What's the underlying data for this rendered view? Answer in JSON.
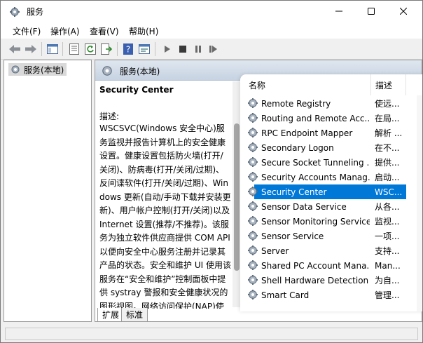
{
  "window": {
    "title": "服务"
  },
  "menu": [
    {
      "label": "文件(F)"
    },
    {
      "label": "操作(A)"
    },
    {
      "label": "查看(V)"
    },
    {
      "label": "帮助(H)"
    }
  ],
  "toolbar": {
    "icons": [
      "back-icon",
      "forward-icon",
      "show-tree-icon",
      "properties-icon",
      "refresh-icon",
      "export-icon",
      "help-icon",
      "console-icon",
      "start-icon",
      "stop-icon",
      "pause-icon",
      "restart-icon"
    ]
  },
  "tree": {
    "root": "服务(本地)"
  },
  "pane": {
    "header": "服务(本地)",
    "service_title": "Security Center",
    "desc_label": "描述:",
    "desc_text": "WSCSVC(Windows 安全中心)服务监视并报告计算机上的安全健康设置。健康设置包括防火墙(打开/关闭)、防病毒(打开/关闭/过期)、反间谍软件(打开/关闭/过期)、Windows 更新(自动/手动下载并安装更新)、用户帐户控制(打开/关闭)以及 Internet 设置(推荐/不推荐)。该服务为独立软件供应商提供 COM API 以便向安全中心服务注册并记录其产品的状态。安全和维护 UI 使用该服务在“安全和维护”控制面板中提供 systray 警报和安全健康状况的图形视图。网络访问保护(NAP)使用该服务向 NAP 网络策略服务器报告客户端的安全"
  },
  "list": {
    "columns": {
      "name": "名称",
      "description": "描述"
    },
    "rows": [
      {
        "name": "Remote Registry",
        "desc": "使远..."
      },
      {
        "name": "Routing and Remote Acc...",
        "desc": "在局..."
      },
      {
        "name": "RPC Endpoint Mapper",
        "desc": "解析 ..."
      },
      {
        "name": "Secondary Logon",
        "desc": "在不..."
      },
      {
        "name": "Secure Socket Tunneling ...",
        "desc": "提供..."
      },
      {
        "name": "Security Accounts Manag...",
        "desc": "启动..."
      },
      {
        "name": "Security Center",
        "desc": "WSC...",
        "selected": true
      },
      {
        "name": "Sensor Data Service",
        "desc": "从各..."
      },
      {
        "name": "Sensor Monitoring Service",
        "desc": "监视..."
      },
      {
        "name": "Sensor Service",
        "desc": "一项..."
      },
      {
        "name": "Server",
        "desc": "支持..."
      },
      {
        "name": "Shared PC Account Mana...",
        "desc": "Man..."
      },
      {
        "name": "Shell Hardware Detection",
        "desc": "为自..."
      },
      {
        "name": "Smart Card",
        "desc": "管理..."
      }
    ]
  },
  "tabs": [
    {
      "label": "扩展"
    },
    {
      "label": "标准"
    }
  ],
  "colors": {
    "selection": "#0078d7",
    "header_gradient_top": "#dfe6ef",
    "header_gradient_bottom": "#c7d3e2"
  }
}
